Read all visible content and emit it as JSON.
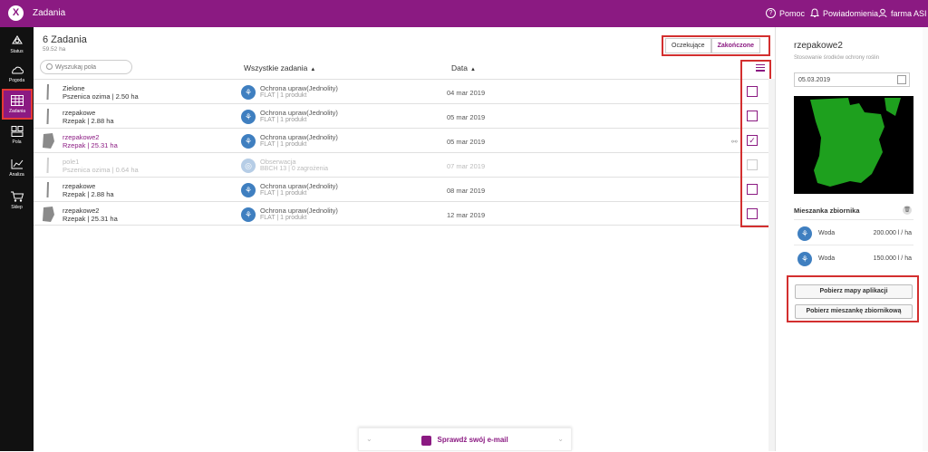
{
  "app": {
    "logo": "X",
    "title": "Zadania"
  },
  "topbar": {
    "help": "Pomoc",
    "notifications": "Powiadomienia",
    "user": "farma ASI"
  },
  "nav": [
    {
      "label": "Status",
      "icon": "status-icon"
    },
    {
      "label": "Pogoda",
      "icon": "weather-icon"
    },
    {
      "label": "Zadania",
      "icon": "tasks-icon",
      "active": true
    },
    {
      "label": "Pola",
      "icon": "fields-icon"
    },
    {
      "label": "Analiza",
      "icon": "analysis-icon"
    },
    {
      "label": "Sklep",
      "icon": "shop-icon"
    }
  ],
  "main": {
    "count_title": "6 Zadania",
    "count_sub": "59.52 ha",
    "status_pending": "Oczekujące",
    "status_done": "Zakończone",
    "search_placeholder": "Wyszukaj pola",
    "col_tasks": "Wszystkie zadania",
    "col_date": "Data"
  },
  "rows": [
    {
      "field": "Zielone",
      "sub": "Pszenica ozima | 2.50 ha",
      "task": "Ochrona upraw(Jednolity)",
      "task_sub": "FLAT | 1 produkt",
      "date": "04 mar 2019",
      "checked": false
    },
    {
      "field": "rzepakowe",
      "sub": "Rzepak | 2.88 ha",
      "task": "Ochrona upraw(Jednolity)",
      "task_sub": "FLAT | 1 produkt",
      "date": "05 mar 2019",
      "checked": false
    },
    {
      "field": "rzepakowe2",
      "sub": "Rzepak | 25.31 ha",
      "task": "Ochrona upraw(Jednolity)",
      "task_sub": "FLAT | 1 produkt",
      "date": "05 mar 2019",
      "checked": true
    },
    {
      "field": "pole1",
      "sub": "Pszenica ozima | 0.64 ha",
      "task": "Obserwacja",
      "task_sub": "BBCH 13 | 0 zagrożenia",
      "date": "07 mar 2019",
      "checked": false,
      "dim": true
    },
    {
      "field": "rzepakowe",
      "sub": "Rzepak | 2.88 ha",
      "task": "Ochrona upraw(Jednolity)",
      "task_sub": "FLAT | 1 produkt",
      "date": "08 mar 2019",
      "checked": false
    },
    {
      "field": "rzepakowe2",
      "sub": "Rzepak | 25.31 ha",
      "task": "Ochrona upraw(Jednolity)",
      "task_sub": "FLAT | 1 produkt",
      "date": "12 mar 2019",
      "checked": false
    }
  ],
  "email_bar": {
    "text": "Sprawdź swój e-mail"
  },
  "panel": {
    "title": "rzepakowe2",
    "subtitle": "Stosowanie środków ochrony roślin",
    "date": "05.03.2019",
    "mix_title": "Mieszanka zbiornika",
    "mix": [
      {
        "name": "Woda",
        "value": "200.000 l / ha"
      },
      {
        "name": "Woda",
        "value": "150.000 l / ha"
      }
    ],
    "btn_maps": "Pobierz mapy aplikacji",
    "btn_mix": "Pobierz mieszankę zbiornikową"
  },
  "colors": {
    "brand": "#8b1a82",
    "nav_bg": "#111111",
    "task_icon": "#3f7fc0",
    "highlight_border": "#d32f2f"
  }
}
